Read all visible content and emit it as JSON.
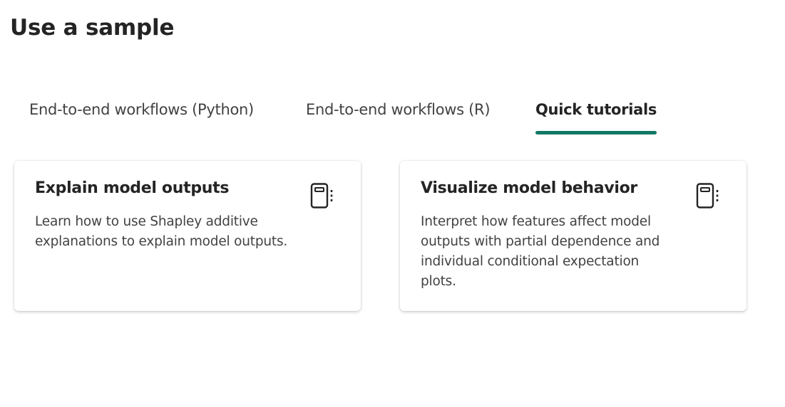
{
  "page": {
    "title": "Use a sample"
  },
  "tabs": [
    {
      "label": "End-to-end workflows (Python)",
      "active": false
    },
    {
      "label": "End-to-end workflows (R)",
      "active": false
    },
    {
      "label": "Quick tutorials",
      "active": true
    }
  ],
  "cards": [
    {
      "title": "Explain model outputs",
      "description": "Learn how to use Shapley additive explanations to explain model outputs.",
      "icon": "notebook-icon"
    },
    {
      "title": "Visualize model behavior",
      "description": "Interpret how features affect model outputs with partial dependence and individual conditional expectation plots.",
      "icon": "notebook-icon"
    }
  ],
  "colors": {
    "accent": "#117865",
    "text_primary": "#242424",
    "text_secondary": "#424242"
  }
}
